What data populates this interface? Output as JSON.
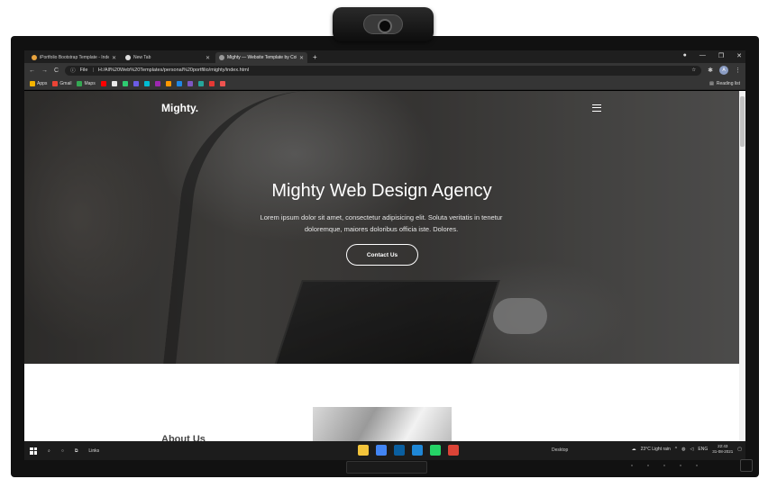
{
  "browser": {
    "tabs": [
      {
        "title": "iPortfolio Bootstrap Template - Inde",
        "active": false
      },
      {
        "title": "New Tab",
        "active": false
      },
      {
        "title": "Mighty — Website Template by Col",
        "active": true
      }
    ],
    "new_tab": "+",
    "url_prefix": "File",
    "url": "H:/All%20Web%20Templates/personal%20portfilio/mighty/index.html",
    "avatar_initials": "A",
    "bookmarks": [
      {
        "label": "Apps",
        "color": "#f4b400"
      },
      {
        "label": "Gmail",
        "color": "#ea4335"
      },
      {
        "label": "Maps",
        "color": "#34a853"
      },
      {
        "label": "",
        "color": "#ff0000"
      },
      {
        "label": "",
        "color": "#e8e8e8"
      },
      {
        "label": "",
        "color": "#2ecc71"
      },
      {
        "label": "",
        "color": "#6c5ce7"
      },
      {
        "label": "",
        "color": "#00bcd4"
      },
      {
        "label": "",
        "color": "#9c27b0"
      },
      {
        "label": "",
        "color": "#ff9800"
      },
      {
        "label": "",
        "color": "#1e88e5"
      },
      {
        "label": "",
        "color": "#7e57c2"
      },
      {
        "label": "",
        "color": "#26a69a"
      },
      {
        "label": "",
        "color": "#e53935"
      },
      {
        "label": "",
        "color": "#ef5350"
      }
    ],
    "reading_list": "Reading list"
  },
  "page": {
    "brand": "Mighty.",
    "hero_title": "Mighty Web Design Agency",
    "hero_text": "Lorem ipsum dolor sit amet, consectetur adipisicing elit. Soluta veritatis in tenetur doloremque, maiores doloribus officia iste. Dolores.",
    "cta_label": "Contact Us",
    "about_title": "About Us"
  },
  "taskbar": {
    "links_label": "Links",
    "desktop_label": "Desktop",
    "weather": "23°C  Light rain",
    "language": "ENG",
    "time": "22:43",
    "date": "31-08-2021",
    "apps": [
      {
        "name": "file-explorer-icon",
        "color": "#f3c43b"
      },
      {
        "name": "chrome-icon",
        "color": "#4285f4"
      },
      {
        "name": "photoshop-icon",
        "color": "#0a5fa0"
      },
      {
        "name": "vscode-icon",
        "color": "#1f87d6"
      },
      {
        "name": "whatsapp-icon",
        "color": "#25d366"
      },
      {
        "name": "chrome-profile-icon",
        "color": "#db4437"
      }
    ]
  }
}
